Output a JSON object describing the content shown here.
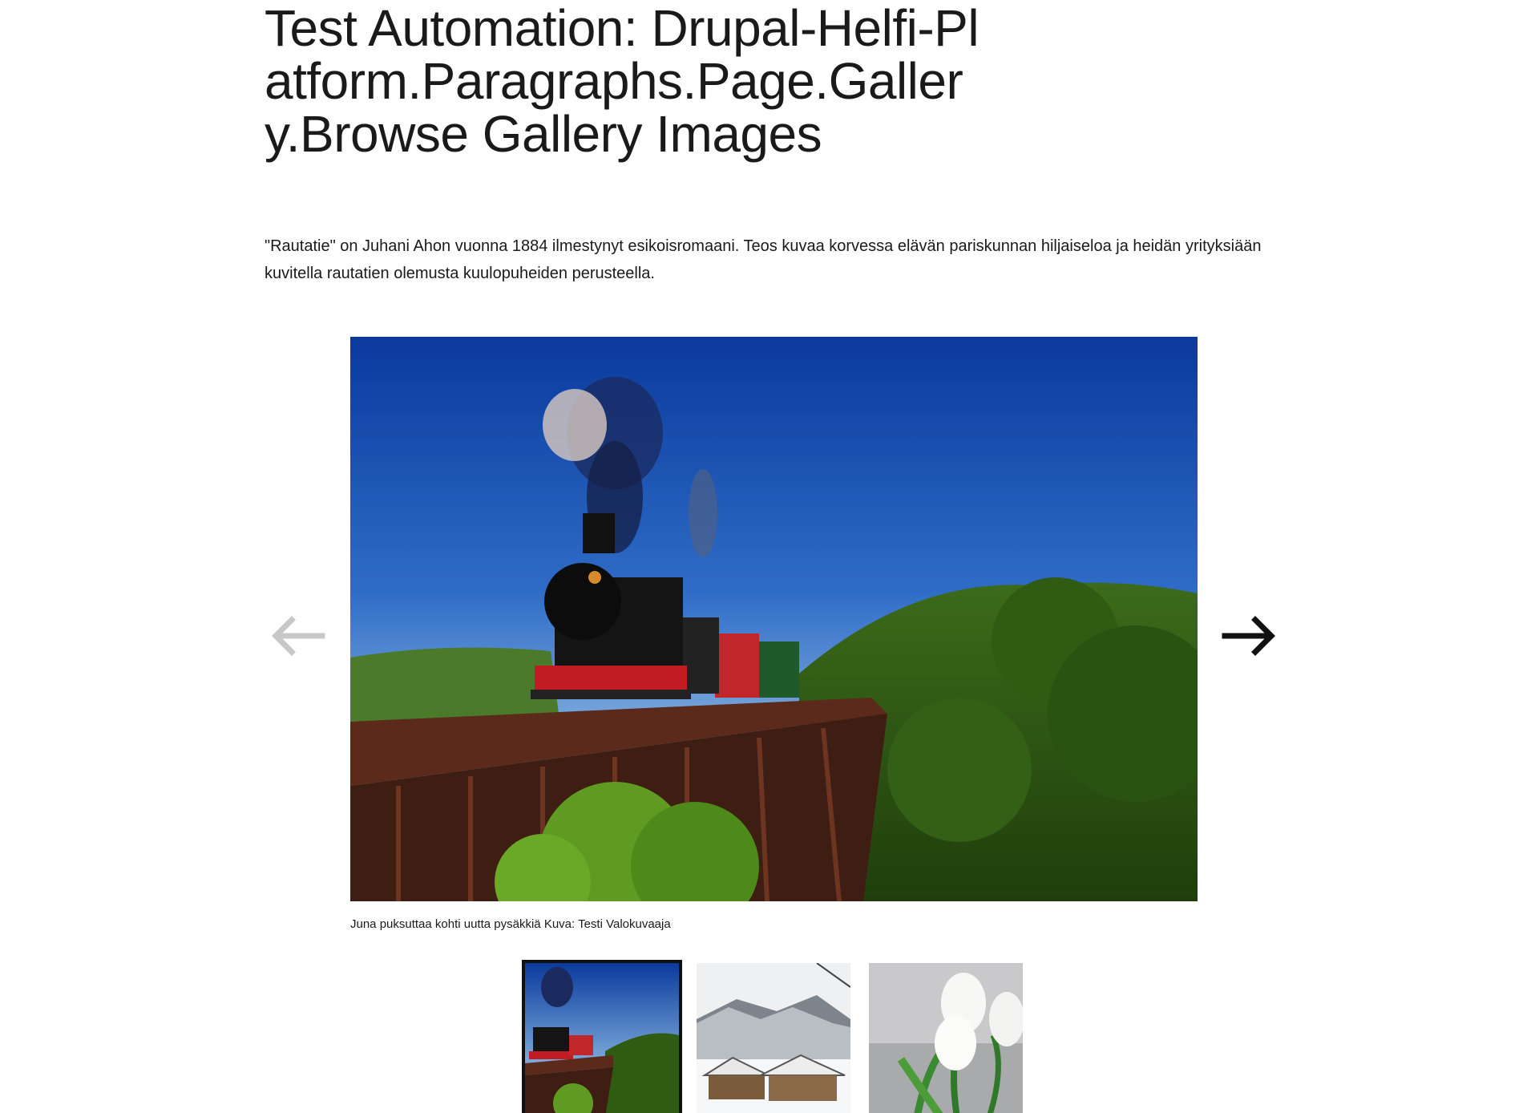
{
  "page": {
    "title": "Test Automation: Drupal-Helfi-Platform.Paragraphs.Page.Gallery.Browse Gallery Images",
    "lead": "\"Rautatie\" on Juhani Ahon vuonna 1884 ilmestynyt esikoisromaani. Teos kuvaa korvessa elävän pariskunnan hiljaiseloa ja heidän yrityksiään kuvitella rautatien olemusta kuulopuheiden perusteella."
  },
  "gallery": {
    "caption": "Juna puksuttaa kohti uutta pysäkkiä Kuva: Testi Valokuvaaja",
    "prev_icon": "arrow-left-icon",
    "next_icon": "arrow-right-icon",
    "prev_disabled": true,
    "selected_index": 0,
    "thumbnails": [
      {
        "subject": "steam-train-on-bridge",
        "selected": true
      },
      {
        "subject": "snowy-village-mountains",
        "selected": false
      },
      {
        "subject": "white-tulips",
        "selected": false
      }
    ],
    "colors": {
      "arrow_disabled": "#c8c8c8",
      "arrow_active": "#111111",
      "thumb_border": "#111111"
    }
  }
}
